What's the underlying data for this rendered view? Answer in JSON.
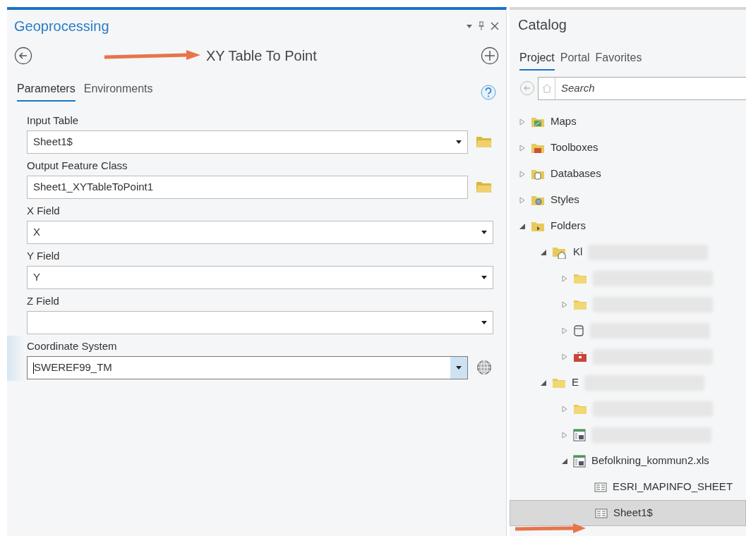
{
  "geoprocessing": {
    "title": "Geoprocessing",
    "tool_title": "XY Table To Point",
    "tabs": [
      {
        "label": "Parameters",
        "selected": true
      },
      {
        "label": "Environments",
        "selected": false
      }
    ],
    "parameters": [
      {
        "kind": "dataset",
        "label": "Input Table",
        "value": "Sheet1$",
        "dropdown": true,
        "active": false
      },
      {
        "kind": "dataset",
        "label": "Output Feature Class",
        "value": "Sheet1_XYTableToPoint1",
        "dropdown": false,
        "active": false
      },
      {
        "kind": "field",
        "label": "X Field",
        "value": "X",
        "dropdown": true,
        "active": false
      },
      {
        "kind": "field",
        "label": "Y Field",
        "value": "Y",
        "dropdown": true,
        "active": false
      },
      {
        "kind": "field",
        "label": "Z Field",
        "dropdown": true,
        "active": false
      },
      {
        "kind": "spatial-reference",
        "label": "Coordinate System",
        "value": "SWEREF99_TM",
        "dropdown": true,
        "active": true
      }
    ]
  },
  "catalog": {
    "title": "Catalog",
    "tabs": [
      {
        "label": "Project",
        "selected": true
      },
      {
        "label": "Portal",
        "selected": false
      },
      {
        "label": "Favorites",
        "selected": false
      }
    ],
    "search": {
      "placeholder": "Search"
    },
    "tree": [
      {
        "kind": "map",
        "label": "Maps",
        "expanded": false,
        "selected": false,
        "redacted": false
      },
      {
        "kind": "toolbox-folder",
        "label": "Toolboxes",
        "expanded": false,
        "selected": false,
        "redacted": false
      },
      {
        "kind": "database-folder",
        "label": "Databases",
        "expanded": false,
        "selected": false,
        "redacted": false
      },
      {
        "kind": "style",
        "label": "Styles",
        "expanded": false,
        "selected": false,
        "redacted": false
      },
      {
        "kind": "folders",
        "label": "Folders",
        "expanded": true,
        "selected": false,
        "redacted": false,
        "children": [
          {
            "kind": "home-folder",
            "label": "Kl",
            "expanded": true,
            "selected": false,
            "redacted": true,
            "children": [
              {
                "kind": "folder",
                "expanded": false,
                "selected": false,
                "redacted": true
              },
              {
                "kind": "folder",
                "expanded": false,
                "selected": false,
                "redacted": true
              },
              {
                "kind": "database",
                "expanded": false,
                "selected": false,
                "redacted": true
              },
              {
                "kind": "toolbox",
                "expanded": false,
                "selected": false,
                "redacted": true
              }
            ]
          },
          {
            "kind": "folder",
            "label": "E",
            "expanded": true,
            "selected": false,
            "redacted": true,
            "children": [
              {
                "kind": "folder",
                "expanded": false,
                "selected": false,
                "redacted": true
              },
              {
                "kind": "workbook",
                "expanded": false,
                "selected": false,
                "redacted": true
              },
              {
                "kind": "workbook",
                "label": "Befolkning_kommun2.xls",
                "expanded": true,
                "selected": false,
                "redacted": false,
                "children": [
                  {
                    "kind": "table",
                    "label": "ESRI_MAPINFO_SHEET",
                    "selected": false,
                    "redacted": false
                  },
                  {
                    "kind": "table",
                    "label": "Sheet1$",
                    "selected": true,
                    "redacted": false
                  }
                ]
              }
            ]
          }
        ]
      }
    ]
  }
}
